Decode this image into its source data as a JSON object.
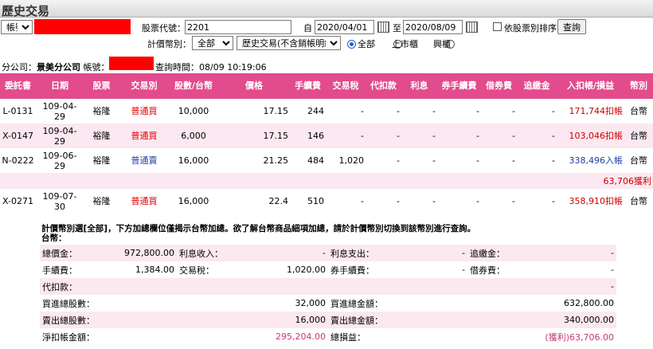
{
  "page": {
    "title": "歷史交易"
  },
  "filters": {
    "account_select": "帳號",
    "stock_code_label": "股票代號：",
    "stock_code_value": "2201",
    "from_label": "自",
    "from_date": "2020/04/01",
    "to_label": "至",
    "to_date": "2020/08/09",
    "sort_label": "依股票別排序",
    "query_button": "查詢",
    "currency_label": "計價幣別：",
    "currency_value": "全部",
    "type_value": "歷史交易(不含銷帳明細)",
    "market_options": [
      "全部",
      "上市櫃",
      "興櫃"
    ],
    "market_selected": "全部"
  },
  "info": {
    "branch_label": "分公司：",
    "branch_value": "景美分公司",
    "account_label": "帳號：",
    "query_time_label": "查詢時間：",
    "query_time_value": "08/09 10:19:06"
  },
  "table": {
    "headers": [
      "委託書",
      "日期",
      "股票",
      "交易別",
      "股數/台幣",
      "價格",
      "手續費",
      "交易稅",
      "代扣款",
      "利息",
      "券手續費",
      "借券費",
      "追繳金",
      "入扣帳/損益",
      "幣別"
    ],
    "rows": [
      {
        "order": "L-0131",
        "date": "109-04-29",
        "stock": "裕隆",
        "type": "普通買",
        "type_class": "buy",
        "qty": "10,000",
        "price": "17.15",
        "fee": "244",
        "tax": "-",
        "withhold": "-",
        "interest": "-",
        "lend_fee": "-",
        "borrow_fee": "-",
        "margin": "-",
        "amount": "171,744扣帳",
        "amount_class": "loss",
        "currency": "台幣"
      },
      {
        "order": "X-0147",
        "date": "109-04-29",
        "stock": "裕隆",
        "type": "普通買",
        "type_class": "buy",
        "qty": "6,000",
        "price": "17.15",
        "fee": "146",
        "tax": "-",
        "withhold": "-",
        "interest": "-",
        "lend_fee": "-",
        "borrow_fee": "-",
        "margin": "-",
        "amount": "103,046扣帳",
        "amount_class": "loss",
        "currency": "台幣"
      },
      {
        "order": "N-0222",
        "date": "109-06-29",
        "stock": "裕隆",
        "type": "普通賣",
        "type_class": "sell",
        "qty": "16,000",
        "price": "21.25",
        "fee": "484",
        "tax": "1,020",
        "withhold": "-",
        "interest": "-",
        "lend_fee": "-",
        "borrow_fee": "-",
        "margin": "-",
        "amount": "338,496入帳",
        "amount_class": "gain",
        "currency": "台幣"
      },
      {
        "order": "X-0271",
        "date": "109-07-30",
        "stock": "裕隆",
        "type": "普通買",
        "type_class": "buy",
        "qty": "16,000",
        "price": "22.4",
        "fee": "510",
        "tax": "-",
        "withhold": "-",
        "interest": "-",
        "lend_fee": "-",
        "borrow_fee": "-",
        "margin": "-",
        "amount": "358,910扣帳",
        "amount_class": "loss",
        "currency": "台幣"
      }
    ],
    "subtotal": "63,706獲利"
  },
  "summary": {
    "note": "計價幣別選[全部]，下方加總欄位僅揭示台幣加總。欲了解台幣商品細項加總，請於計價幣別切換到該幣別進行查詢。",
    "currency_line": "台幣：",
    "total_price_label": "總價金：",
    "total_price": "972,800.00",
    "interest_income_label": "利息收入：",
    "interest_income": "-",
    "interest_expense_label": "利息支出：",
    "interest_expense": "-",
    "margin_label": "追繳金：",
    "margin": "-",
    "fee_label": "手續費：",
    "fee": "1,384.00",
    "tax_label": "交易稅：",
    "tax": "1,020.00",
    "lend_fee_label": "券手續費：",
    "lend_fee": "-",
    "borrow_fee_label": "借券費：",
    "borrow_fee": "-",
    "withhold_label": "代扣款：",
    "withhold": "-",
    "buy_shares_label": "買進總股數：",
    "buy_shares": "32,000",
    "buy_amount_label": "買進總金額：",
    "buy_amount": "632,800.00",
    "sell_shares_label": "賣出總股數：",
    "sell_shares": "16,000",
    "sell_amount_label": "賣出總金額：",
    "sell_amount": "340,000.00",
    "net_label": "淨扣帳金額：",
    "net": "295,204.00",
    "pl_label": "總損益：",
    "pl": "(獲利)63,706.00"
  }
}
